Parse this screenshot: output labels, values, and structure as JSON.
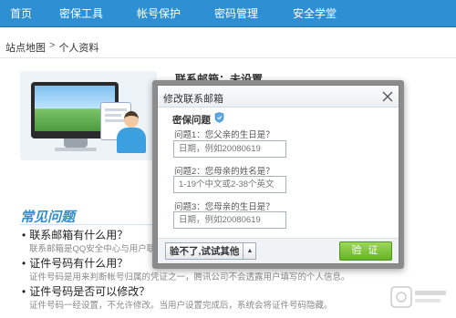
{
  "nav": {
    "items": [
      {
        "label": "首页"
      },
      {
        "label": "密保工具"
      },
      {
        "label": "帐号保护"
      },
      {
        "label": "密码管理"
      },
      {
        "label": "安全学堂"
      }
    ]
  },
  "breadcrumb": {
    "root": "站点地图",
    "separator": ">",
    "current": "个人资料"
  },
  "profile": {
    "email_status": "联系邮箱：未设置"
  },
  "faq": {
    "title": "常见问题",
    "items": [
      {
        "question": "联系邮箱有什么用？",
        "answer": "联系邮箱是QQ安全中心与用户联系的"
      },
      {
        "question": "证件号码有什么用？",
        "answer": "证件号码是用来判断帐号归属的凭证之一，腾讯公司不会透露用户填写的个人信息。"
      },
      {
        "question": "证件号码是否可以修改？",
        "answer": "证件号码一经设置，不允许修改。当用户设置完成后，系统会将证件号码隐藏。"
      }
    ]
  },
  "dialog": {
    "title": "修改联系邮箱",
    "section_title": "密保问题",
    "questions": [
      {
        "label": "问题1：您父亲的生日是？",
        "placeholder": "日期，例如20080619"
      },
      {
        "label": "问题2：您母亲的姓名是？",
        "placeholder": "1-19个中文或2-38个英文"
      },
      {
        "label": "问题3：您母亲的生日是？",
        "placeholder": "日期，例如20080619"
      }
    ],
    "alt_button": "验不了,试试其他",
    "verify_button": "验 证"
  },
  "colors": {
    "nav_bg": "#2e8fd3",
    "verify_green": "#66b426",
    "faq_blue": "#2e8fd3"
  }
}
